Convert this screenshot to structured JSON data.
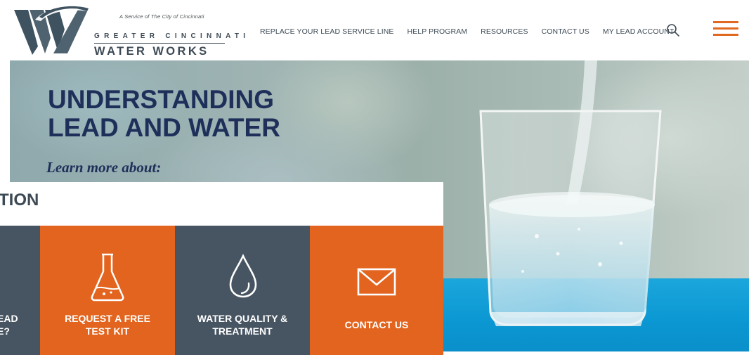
{
  "header": {
    "tagline": "A Service of The City of Cincinnati",
    "brand_top": "GREATER CINCINNATI",
    "brand_bottom": "WATER WORKS",
    "nav": [
      {
        "label": "REPLACE YOUR LEAD SERVICE LINE"
      },
      {
        "label": "HELP PROGRAM"
      },
      {
        "label": "RESOURCES"
      },
      {
        "label": "CONTACT US"
      },
      {
        "label": "MY LEAD ACCOUNT"
      }
    ],
    "search_icon": "search-icon",
    "menu_icon": "hamburger-menu-icon"
  },
  "hero": {
    "title": "UNDERSTANDING\nLEAD AND WATER",
    "subtitle": "Learn more about:"
  },
  "panel": {
    "heading": "TION",
    "tiles": [
      {
        "label": "EAD\nE?",
        "icon": "none"
      },
      {
        "label": "REQUEST A FREE\nTEST KIT",
        "icon": "flask-icon"
      },
      {
        "label": "WATER QUALITY &\nTREATMENT",
        "icon": "water-drop-icon"
      },
      {
        "label": "CONTACT US",
        "icon": "envelope-icon"
      }
    ]
  },
  "colors": {
    "accent_orange": "#e2641e",
    "slate": "#475562",
    "navy": "#1e2f5a",
    "table_blue": "#0b97d2"
  }
}
